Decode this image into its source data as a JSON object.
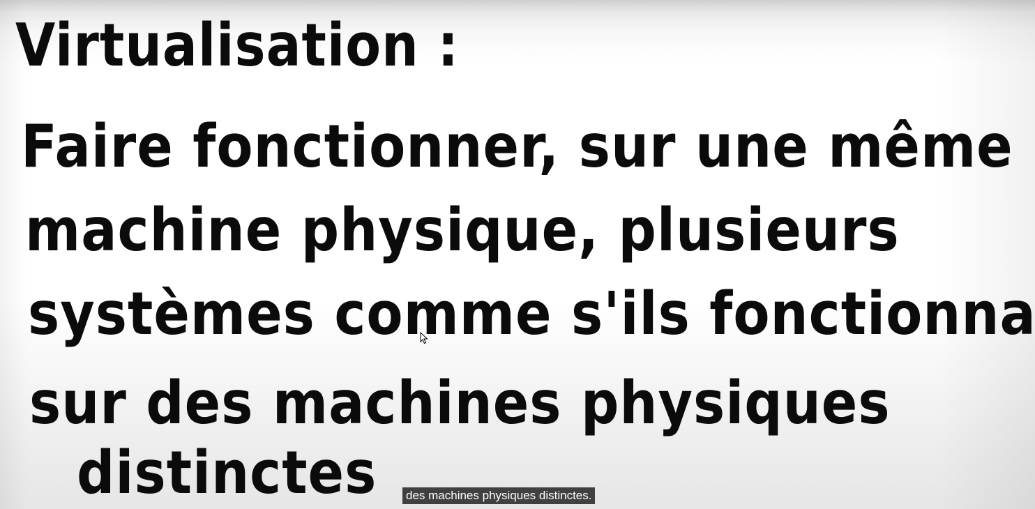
{
  "video": {
    "handwritten_text": {
      "title": "Virtualisation :",
      "line1": "Faire fonctionner, sur une même",
      "line2": "machine physique, plusieurs",
      "line3": "systèmes comme s'ils fonctionnaient",
      "line4": "sur des machines physiques",
      "line5": "distinctes"
    },
    "subtitle": "des machines physiques distinctes.",
    "cursor_icon": "mouse-pointer-icon"
  }
}
